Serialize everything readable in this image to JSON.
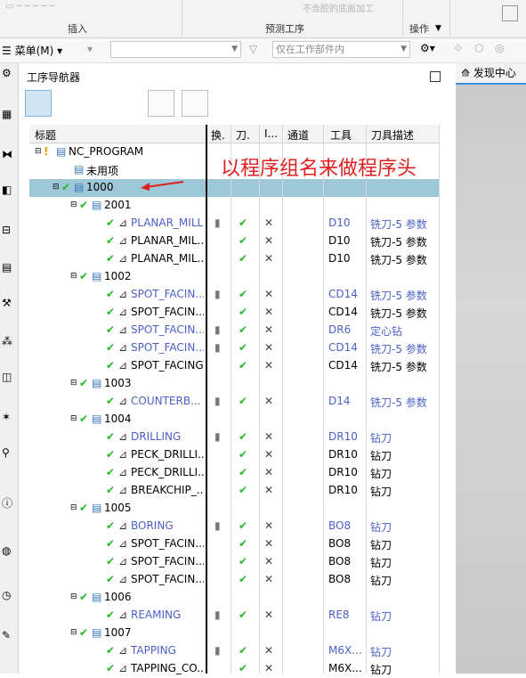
{
  "ribbon": {
    "groups": [
      "插入",
      "预测工序",
      "操作"
    ],
    "faint_text": "不含腔的底面加工"
  },
  "toolbar": {
    "menu_label": "菜单(M)",
    "filter_placeholder": "仅在工作部件内"
  },
  "navigator": {
    "title": "工序导航器"
  },
  "right_panel": {
    "tab_label": "发现中心"
  },
  "columns": [
    "标题",
    "换.",
    "刀.",
    "I...",
    "通道",
    "工具",
    "刀具描述"
  ],
  "annotation": "以程序组名来做程序头",
  "rows": [
    {
      "name": "NC_PROGRAM",
      "tool": "",
      "desc": "",
      "blue": false,
      "kind": "root"
    },
    {
      "name": "未用项",
      "tool": "",
      "desc": "",
      "blue": false,
      "kind": "folder"
    },
    {
      "name": "1000",
      "tool": "",
      "desc": "",
      "blue": false,
      "kind": "group",
      "selected": true
    },
    {
      "name": "2001",
      "tool": "",
      "desc": "",
      "blue": false,
      "kind": "group"
    },
    {
      "name": "PLANAR_MILL",
      "tool": "D10",
      "desc": "铣刀-5 参数",
      "blue": true,
      "kind": "op"
    },
    {
      "name": "PLANAR_MIL...",
      "tool": "D10",
      "desc": "铣刀-5 参数",
      "blue": false,
      "kind": "op"
    },
    {
      "name": "PLANAR_MIL...",
      "tool": "D10",
      "desc": "铣刀-5 参数",
      "blue": false,
      "kind": "op"
    },
    {
      "name": "1002",
      "tool": "",
      "desc": "",
      "blue": false,
      "kind": "group"
    },
    {
      "name": "SPOT_FACIN...",
      "tool": "CD14",
      "desc": "铣刀-5 参数",
      "blue": true,
      "kind": "op"
    },
    {
      "name": "SPOT_FACIN...",
      "tool": "CD14",
      "desc": "铣刀-5 参数",
      "blue": false,
      "kind": "op"
    },
    {
      "name": "SPOT_FACIN...",
      "tool": "DR6",
      "desc": "定心钻",
      "blue": true,
      "kind": "op"
    },
    {
      "name": "SPOT_FACIN...",
      "tool": "CD14",
      "desc": "铣刀-5 参数",
      "blue": true,
      "kind": "op"
    },
    {
      "name": "SPOT_FACING",
      "tool": "CD14",
      "desc": "铣刀-5 参数",
      "blue": false,
      "kind": "op"
    },
    {
      "name": "1003",
      "tool": "",
      "desc": "",
      "blue": false,
      "kind": "group"
    },
    {
      "name": "COUNTERB...",
      "tool": "D14",
      "desc": "铣刀-5 参数",
      "blue": true,
      "kind": "op"
    },
    {
      "name": "1004",
      "tool": "",
      "desc": "",
      "blue": false,
      "kind": "group"
    },
    {
      "name": "DRILLING",
      "tool": "DR10",
      "desc": "钻刀",
      "blue": true,
      "kind": "op"
    },
    {
      "name": "PECK_DRILLI...",
      "tool": "DR10",
      "desc": "钻刀",
      "blue": false,
      "kind": "op"
    },
    {
      "name": "PECK_DRILLI...",
      "tool": "DR10",
      "desc": "钻刀",
      "blue": false,
      "kind": "op"
    },
    {
      "name": "BREAKCHIP_...",
      "tool": "DR10",
      "desc": "钻刀",
      "blue": false,
      "kind": "op"
    },
    {
      "name": "1005",
      "tool": "",
      "desc": "",
      "blue": false,
      "kind": "group"
    },
    {
      "name": "BORING",
      "tool": "BO8",
      "desc": "钻刀",
      "blue": true,
      "kind": "op"
    },
    {
      "name": "SPOT_FACIN...",
      "tool": "BO8",
      "desc": "钻刀",
      "blue": false,
      "kind": "op"
    },
    {
      "name": "SPOT_FACIN...",
      "tool": "BO8",
      "desc": "钻刀",
      "blue": false,
      "kind": "op"
    },
    {
      "name": "SPOT_FACIN...",
      "tool": "BO8",
      "desc": "钻刀",
      "blue": false,
      "kind": "op"
    },
    {
      "name": "1006",
      "tool": "",
      "desc": "",
      "blue": false,
      "kind": "group"
    },
    {
      "name": "REAMING",
      "tool": "RE8",
      "desc": "钻刀",
      "blue": true,
      "kind": "op"
    },
    {
      "name": "1007",
      "tool": "",
      "desc": "",
      "blue": false,
      "kind": "group"
    },
    {
      "name": "TAPPING",
      "tool": "M6X...",
      "desc": "钻刀",
      "blue": true,
      "kind": "op"
    },
    {
      "name": "TAPPING_CO...",
      "tool": "M6X...",
      "desc": "钻刀",
      "blue": false,
      "kind": "op"
    }
  ]
}
